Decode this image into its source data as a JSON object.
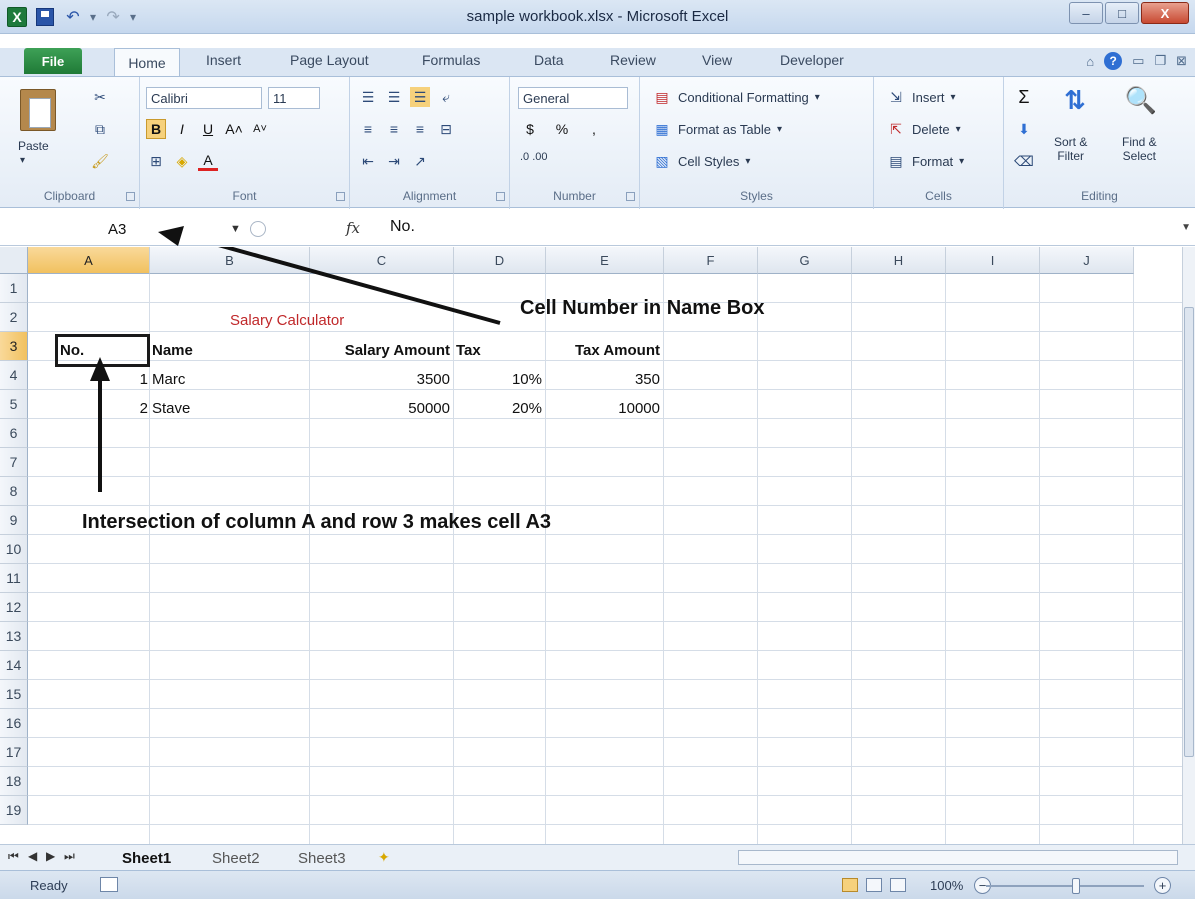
{
  "window": {
    "title": "sample workbook.xlsx - Microsoft Excel",
    "controls": [
      "–",
      "□",
      "X"
    ]
  },
  "ribbon_tabs": [
    "File",
    "Home",
    "Insert",
    "Page Layout",
    "Formulas",
    "Data",
    "Review",
    "View",
    "Developer"
  ],
  "ribbon": {
    "clipboard": {
      "label": "Clipboard",
      "paste": "Paste"
    },
    "font": {
      "label": "Font",
      "name": "Calibri",
      "size": "11"
    },
    "alignment": {
      "label": "Alignment"
    },
    "number": {
      "label": "Number",
      "format": "General",
      "currency": "$",
      "percent": "%",
      "comma": ",",
      "decimals": ".0 .00"
    },
    "styles": {
      "label": "Styles",
      "conditional": "Conditional Formatting",
      "format_table": "Format as Table",
      "cell_styles": "Cell Styles"
    },
    "cells": {
      "label": "Cells",
      "insert": "Insert",
      "delete": "Delete",
      "format": "Format"
    },
    "editing": {
      "label": "Editing",
      "sort": "Sort &",
      "sort2": "Filter",
      "find": "Find &",
      "find2": "Select"
    }
  },
  "formula_bar": {
    "name_box": "A3",
    "fx": "fx",
    "value": "No."
  },
  "grid": {
    "columns": [
      "A",
      "B",
      "C",
      "D",
      "E",
      "F",
      "G",
      "H",
      "I",
      "J"
    ],
    "rows": [
      "1",
      "2",
      "3",
      "4",
      "5",
      "6",
      "7",
      "8",
      "9",
      "10",
      "11",
      "12",
      "13",
      "14",
      "15",
      "16",
      "17",
      "18",
      "19"
    ],
    "selected_column": "A",
    "selected_row": "3"
  },
  "cells": {
    "b2": "Salary Calculator",
    "a3": "No.",
    "b3": "Name",
    "c3": "Salary Amount",
    "d3": "Tax",
    "e3": "Tax Amount",
    "a4": "1",
    "b4": "Marc",
    "c4": "3500",
    "d4": "10%",
    "e4": "350",
    "a5": "2",
    "b5": "Stave",
    "c5": "50000",
    "d5": "20%",
    "e5": "10000"
  },
  "annotations": {
    "name_box_note": "Cell Number in Name Box",
    "intersection_note": "Intersection of column A and row 3 makes cell A3"
  },
  "sheet_tabs": [
    "Sheet1",
    "Sheet2",
    "Sheet3"
  ],
  "status": {
    "ready": "Ready",
    "zoom": "100%"
  }
}
